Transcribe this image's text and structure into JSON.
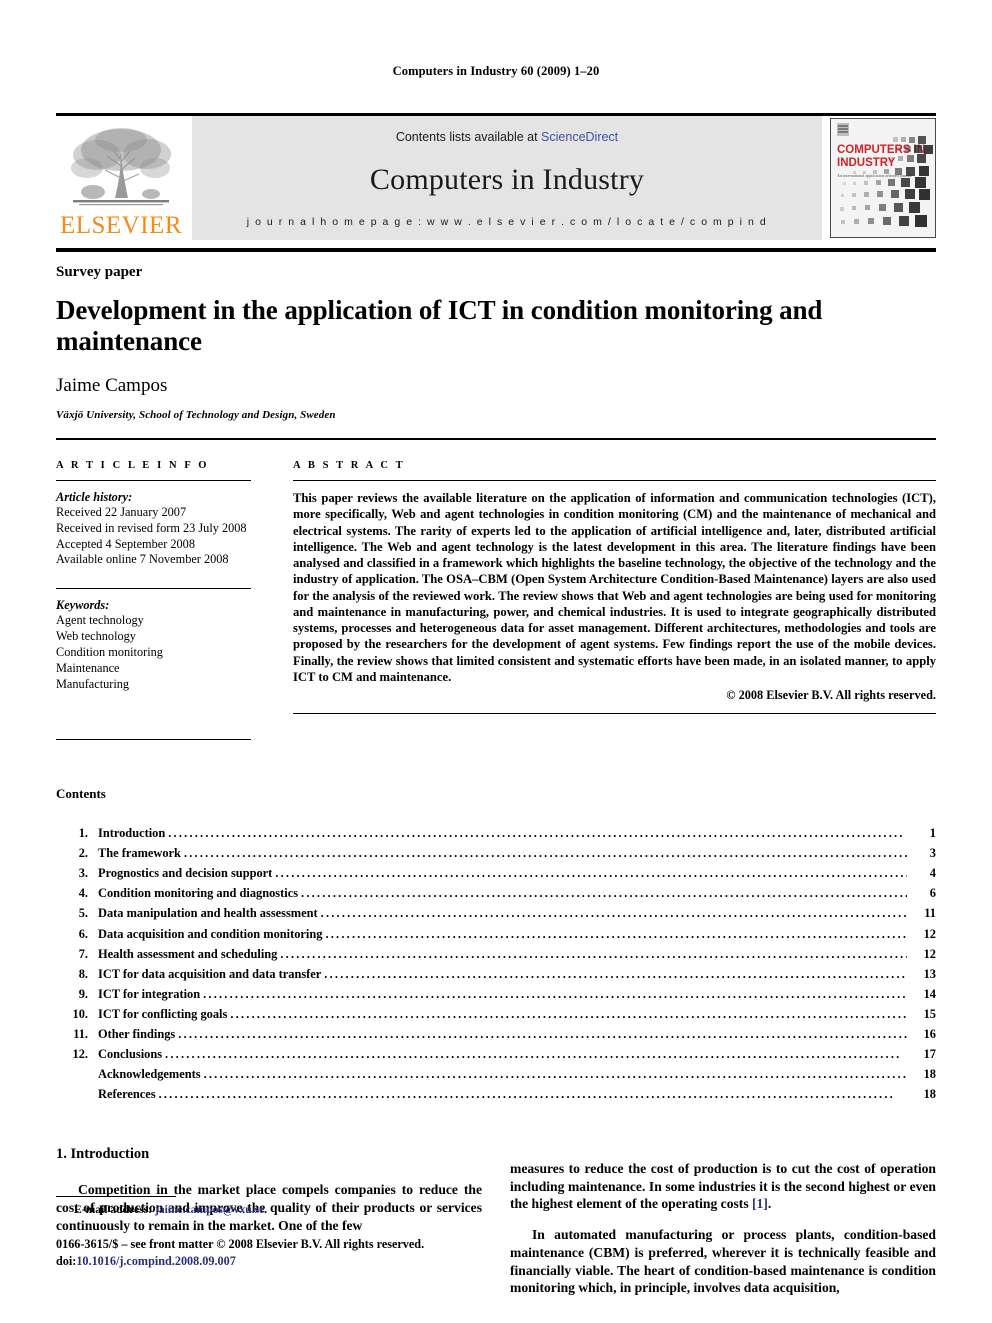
{
  "running_head": "Computers in Industry 60 (2009) 1–20",
  "masthead": {
    "publisher_name": "ELSEVIER",
    "contents_lists_prefix": "Contents lists available at ",
    "sciencedirect": "ScienceDirect",
    "journal_title": "Computers in Industry",
    "journal_homepage": "j o u r n a l   h o m e p a g e :   w w w . e l s e v i e r . c o m / l o c a t e / c o m p i n d",
    "cover_title_line1": "COMPUTERS IN",
    "cover_title_line2": "INDUSTRY",
    "cover_subtitle": "An international application oriented journal",
    "link_color": "#3f51a3",
    "brand_orange": "#F08C1B",
    "cover_red": "#d1232a",
    "band_gray": "#e4e4e4"
  },
  "article": {
    "doctype": "Survey paper",
    "title": "Development in the application of ICT in condition monitoring and maintenance",
    "author": "Jaime Campos",
    "affiliation": "Växjö University, School of Technology and Design, Sweden"
  },
  "article_info": {
    "heading": "A R T I C L E   I N F O",
    "history_label": "Article history:",
    "history": [
      "Received 22 January 2007",
      "Received in revised form 23 July 2008",
      "Accepted 4 September 2008",
      "Available online 7 November 2008"
    ],
    "keywords_label": "Keywords:",
    "keywords": [
      "Agent technology",
      "Web technology",
      "Condition monitoring",
      "Maintenance",
      "Manufacturing"
    ]
  },
  "abstract": {
    "heading": "A B S T R A C T",
    "text": "This paper reviews the available literature on the application of information and communication technologies (ICT), more specifically, Web and agent technologies in condition monitoring (CM) and the maintenance of mechanical and electrical systems. The rarity of experts led to the application of artificial intelligence and, later, distributed artificial intelligence. The Web and agent technology is the latest development in this area. The literature findings have been analysed and classified in a framework which highlights the baseline technology, the objective of the technology and the industry of application. The OSA–CBM (Open System Architecture Condition-Based Maintenance) layers are also used for the analysis of the reviewed work. The review shows that Web and agent technologies are being used for monitoring and maintenance in manufacturing, power, and chemical industries. It is used to integrate geographically distributed systems, processes and heterogeneous data for asset management. Different architectures, methodologies and tools are proposed by the researchers for the development of agent systems. Few findings report the use of the mobile devices. Finally, the review shows that limited consistent and systematic efforts have been made, in an isolated manner, to apply ICT to CM and maintenance.",
    "copyright": "© 2008 Elsevier B.V. All rights reserved."
  },
  "contents": {
    "heading": "Contents",
    "entries": [
      {
        "num": "1.",
        "label": "Introduction",
        "page": "1"
      },
      {
        "num": "2.",
        "label": "The framework",
        "page": "3"
      },
      {
        "num": "3.",
        "label": "Prognostics and decision support",
        "page": "4"
      },
      {
        "num": "4.",
        "label": "Condition monitoring and diagnostics",
        "page": "6"
      },
      {
        "num": "5.",
        "label": "Data manipulation and health assessment",
        "page": "11"
      },
      {
        "num": "6.",
        "label": "Data acquisition and condition monitoring",
        "page": "12"
      },
      {
        "num": "7.",
        "label": "Health assessment and scheduling",
        "page": "12"
      },
      {
        "num": "8.",
        "label": "ICT for data acquisition and data transfer",
        "page": "13"
      },
      {
        "num": "9.",
        "label": "ICT for integration",
        "page": "14"
      },
      {
        "num": "10.",
        "label": "ICT for conflicting goals",
        "page": "15"
      },
      {
        "num": "11.",
        "label": "Other findings",
        "page": "16"
      },
      {
        "num": "12.",
        "label": "Conclusions",
        "page": "17"
      },
      {
        "num": "",
        "label": "Acknowledgements",
        "page": "18"
      },
      {
        "num": "",
        "label": "References",
        "page": "18"
      }
    ]
  },
  "body": {
    "section_heading": "1. Introduction",
    "left_para_1": "Competition in the market place compels companies to reduce the cost of production and improve the quality of their products or services continuously to remain in the market. One of the few",
    "right_para_1_a": "measures to reduce the cost of production is to cut the cost of operation including maintenance. In some industries it is the second highest or even the highest element of the operating costs ",
    "right_para_1_ref": "[1]",
    "right_para_1_b": ".",
    "right_para_2": "In automated manufacturing or process plants, condition-based maintenance (CBM) is preferred, wherever it is technically feasible and financially viable. The heart of condition-based maintenance is condition monitoring which, in principle, involves data acquisition,"
  },
  "footer": {
    "email_label": "E-mail address: ",
    "email": "jaime.campos@vxu.se",
    "email_trail": ".",
    "issn_line": "0166-3615/$ – see front matter © 2008 Elsevier B.V. All rights reserved.",
    "doi_label": "doi:",
    "doi": "10.1016/j.compind.2008.09.007"
  }
}
